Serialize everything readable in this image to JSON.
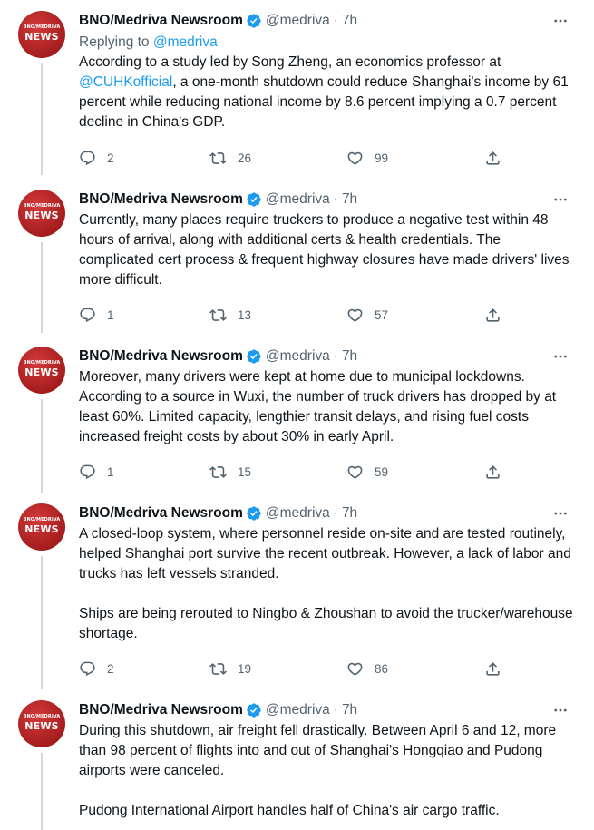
{
  "tweets": [
    {
      "name": "BNO/Medriva Newsroom",
      "handle": "@medriva",
      "dot": "·",
      "time": "7h",
      "replying_prefix": "Replying to ",
      "replying_to": "@medriva",
      "text_parts": {
        "a": "According to a study led by Song Zheng, an economics professor at ",
        "mention": "@CUHKofficial",
        "b": ", a one-month shutdown could reduce Shanghai's income by 61 percent while reducing national income by 8.6 percent implying a 0.7 percent decline in China's GDP."
      },
      "replies": "2",
      "retweets": "26",
      "likes": "99"
    },
    {
      "name": "BNO/Medriva Newsroom",
      "handle": "@medriva",
      "dot": "·",
      "time": "7h",
      "text": "Currently, many places require truckers to produce a negative test within 48 hours of arrival, along with additional certs & health credentials. The complicated cert process & frequent highway closures have made drivers' lives more difficult.",
      "replies": "1",
      "retweets": "13",
      "likes": "57"
    },
    {
      "name": "BNO/Medriva Newsroom",
      "handle": "@medriva",
      "dot": "·",
      "time": "7h",
      "text": "Moreover, many drivers were kept at home due to municipal lockdowns. According to a source in Wuxi, the number of truck drivers has dropped by at least 60%. Limited capacity, lengthier transit delays, and rising fuel costs increased freight costs by about 30% in early April.",
      "replies": "1",
      "retweets": "15",
      "likes": "59"
    },
    {
      "name": "BNO/Medriva Newsroom",
      "handle": "@medriva",
      "dot": "·",
      "time": "7h",
      "text_p1": "A closed-loop system, where personnel reside on-site and are tested routinely, helped Shanghai port survive the recent outbreak. However, a lack of labor and trucks has left vessels stranded.",
      "text_p2": "Ships are being rerouted to Ningbo & Zhoushan to avoid the trucker/warehouse shortage.",
      "replies": "2",
      "retweets": "19",
      "likes": "86"
    },
    {
      "name": "BNO/Medriva Newsroom",
      "handle": "@medriva",
      "dot": "·",
      "time": "7h",
      "text_p1": "During this shutdown, air freight fell drastically. Between April 6 and 12, more than 98 percent of flights into and out of Shanghai's Hongqiao and Pudong airports were canceled.",
      "text_p2": "Pudong International Airport handles half of China's air cargo traffic."
    }
  ],
  "avatar": {
    "small_text": "BNO/MEDRIVA",
    "big_text": "NEWS"
  },
  "colors": {
    "accent": "#1d9bf0",
    "secondary_text": "#536471",
    "avatar_red": "#b22222"
  }
}
